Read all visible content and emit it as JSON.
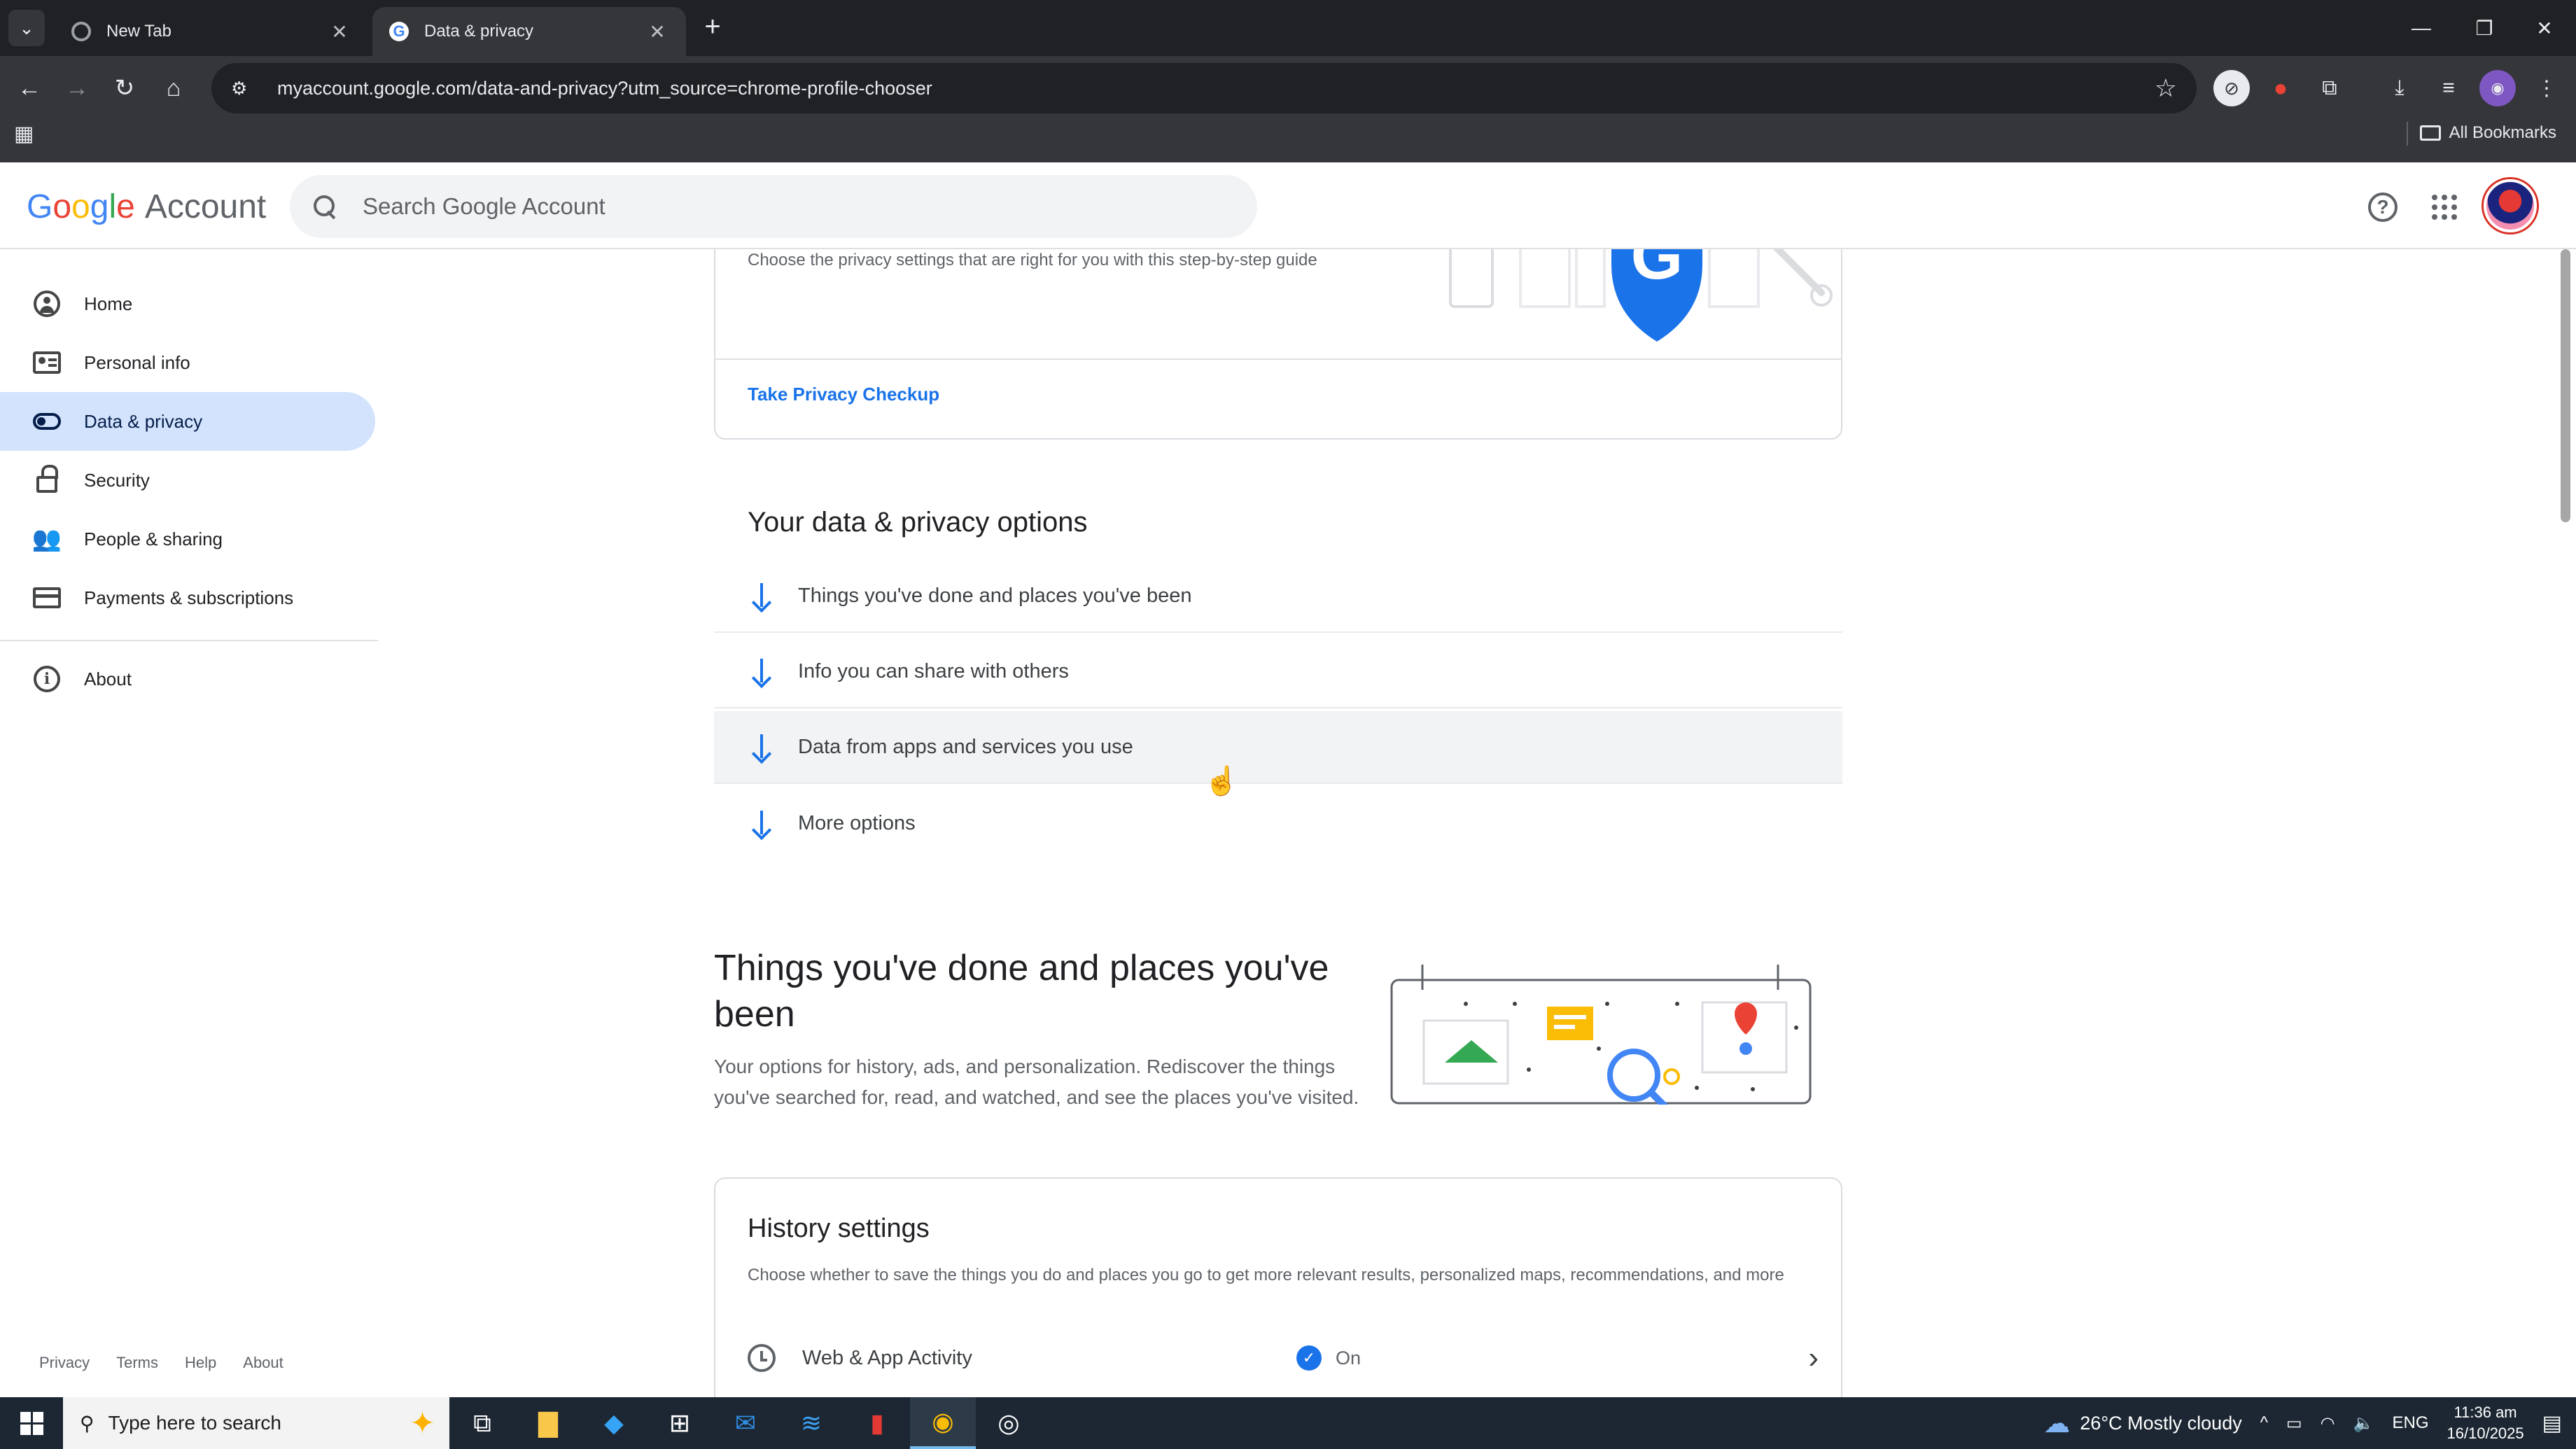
{
  "browser": {
    "tabs": [
      {
        "title": "New Tab",
        "active": false
      },
      {
        "title": "Data & privacy",
        "active": true
      }
    ],
    "url": "myaccount.google.com/data-and-privacy?utm_source=chrome-profile-chooser",
    "bookmarks_label": "All Bookmarks"
  },
  "header": {
    "logo_google": [
      "G",
      "o",
      "o",
      "g",
      "l",
      "e"
    ],
    "logo_account": "Account",
    "search_placeholder": "Search Google Account"
  },
  "sidebar": {
    "items": [
      {
        "label": "Home",
        "icon": "home-icon"
      },
      {
        "label": "Personal info",
        "icon": "personal-info-icon"
      },
      {
        "label": "Data & privacy",
        "icon": "data-privacy-toggle-icon",
        "active": true
      },
      {
        "label": "Security",
        "icon": "lock-icon"
      },
      {
        "label": "People & sharing",
        "icon": "people-icon"
      },
      {
        "label": "Payments & subscriptions",
        "icon": "credit-card-icon"
      },
      {
        "label": "About",
        "icon": "info-icon"
      }
    ],
    "footer": [
      "Privacy",
      "Terms",
      "Help",
      "About"
    ]
  },
  "privacy_checkup": {
    "description": "Choose the privacy settings that are right for you with this step-by-step guide",
    "link": "Take Privacy Checkup"
  },
  "options": {
    "title": "Your data & privacy options",
    "items": [
      "Things you've done and places you've been",
      "Info you can share with others",
      "Data from apps and services you use",
      "More options"
    ]
  },
  "things": {
    "title": "Things you've done and places you've been",
    "description": "Your options for history, ads, and personalization. Rediscover the things you've searched for, read, and watched, and see the places you've visited."
  },
  "history": {
    "title": "History settings",
    "description": "Choose whether to save the things you do and places you go to get more relevant results, personalized maps, recommendations, and more",
    "rows": [
      {
        "label": "Web & App Activity",
        "status": "On"
      }
    ]
  },
  "taskbar": {
    "search_placeholder": "Type here to search",
    "weather": "26°C  Mostly cloudy",
    "lang": "ENG",
    "time": "11:36 am",
    "date": "16/10/2025"
  },
  "colors": {
    "accent": "#1a73e8",
    "active_nav_bg": "#d3e3fd",
    "google_blue": "#4285f4",
    "google_red": "#ea4335",
    "google_yellow": "#fbbc05",
    "google_green": "#34a853"
  }
}
